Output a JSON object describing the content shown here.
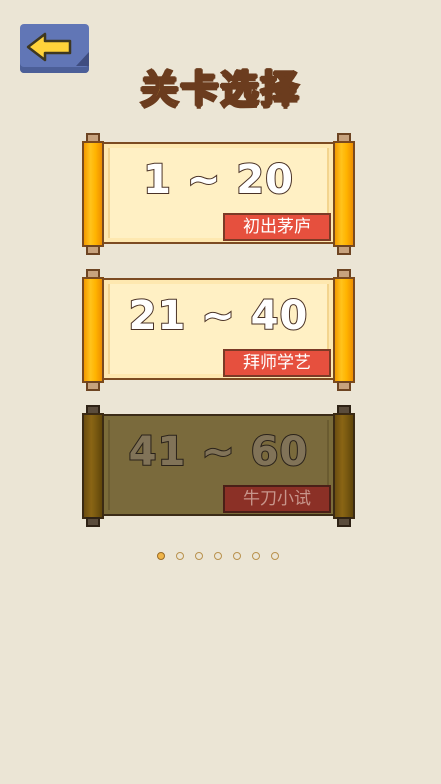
{
  "header": {
    "title": "关卡选择",
    "back_icon": "back-arrow-icon"
  },
  "levels": [
    {
      "range": "1 ~ 20",
      "name": "初出茅庐",
      "locked": false
    },
    {
      "range": "21 ~ 40",
      "name": "拜师学艺",
      "locked": false
    },
    {
      "range": "41 ~ 60",
      "name": "牛刀小试",
      "locked": true
    }
  ],
  "pagination": {
    "total": 7,
    "current": 1
  },
  "colors": {
    "background": "#ebe5d5",
    "title_fill": "#ffd84a",
    "title_outline": "#6b3c1e",
    "back_button": "#6176b6",
    "arrow": "#ffd23a",
    "roller": "#ffb300",
    "paper": "#fff0c4",
    "tag": "#e6503e"
  }
}
